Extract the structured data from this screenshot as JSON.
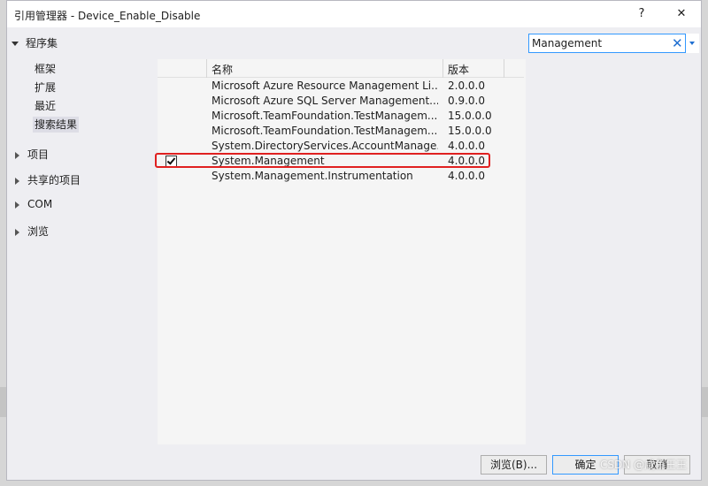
{
  "window": {
    "title": "引用管理器 - Device_Enable_Disable",
    "help_label": "?",
    "close_label": "✕"
  },
  "nav": {
    "header": "程序集",
    "subitems": [
      "框架",
      "扩展",
      "最近",
      "搜索结果"
    ],
    "selected_subitem": "搜索结果",
    "groups": [
      "项目",
      "共享的项目",
      "COM",
      "浏览"
    ]
  },
  "search": {
    "value": "Management",
    "clear_icon": "✕"
  },
  "table": {
    "columns": [
      "名称",
      "版本"
    ],
    "rows": [
      {
        "name": "Microsoft Azure Resource Management Li...",
        "version": "2.0.0.0",
        "checked": false
      },
      {
        "name": "Microsoft Azure SQL Server Management...",
        "version": "0.9.0.0",
        "checked": false
      },
      {
        "name": "Microsoft.TeamFoundation.TestManagem...",
        "version": "15.0.0.0",
        "checked": false
      },
      {
        "name": "Microsoft.TeamFoundation.TestManagem...",
        "version": "15.0.0.0",
        "checked": false
      },
      {
        "name": "System.DirectoryServices.AccountManage...",
        "version": "4.0.0.0",
        "checked": false
      },
      {
        "name": "System.Management",
        "version": "4.0.0.0",
        "checked": true
      },
      {
        "name": "System.Management.Instrumentation",
        "version": "4.0.0.0",
        "checked": false
      }
    ]
  },
  "buttons": {
    "browse": "浏览(B)...",
    "ok": "确定",
    "cancel": "取消"
  },
  "watermark": "CSDN @咸鱼王王",
  "colors": {
    "highlight_border": "#e02020",
    "accent": "#3399ff",
    "dialog_bg": "#eeeef2"
  }
}
